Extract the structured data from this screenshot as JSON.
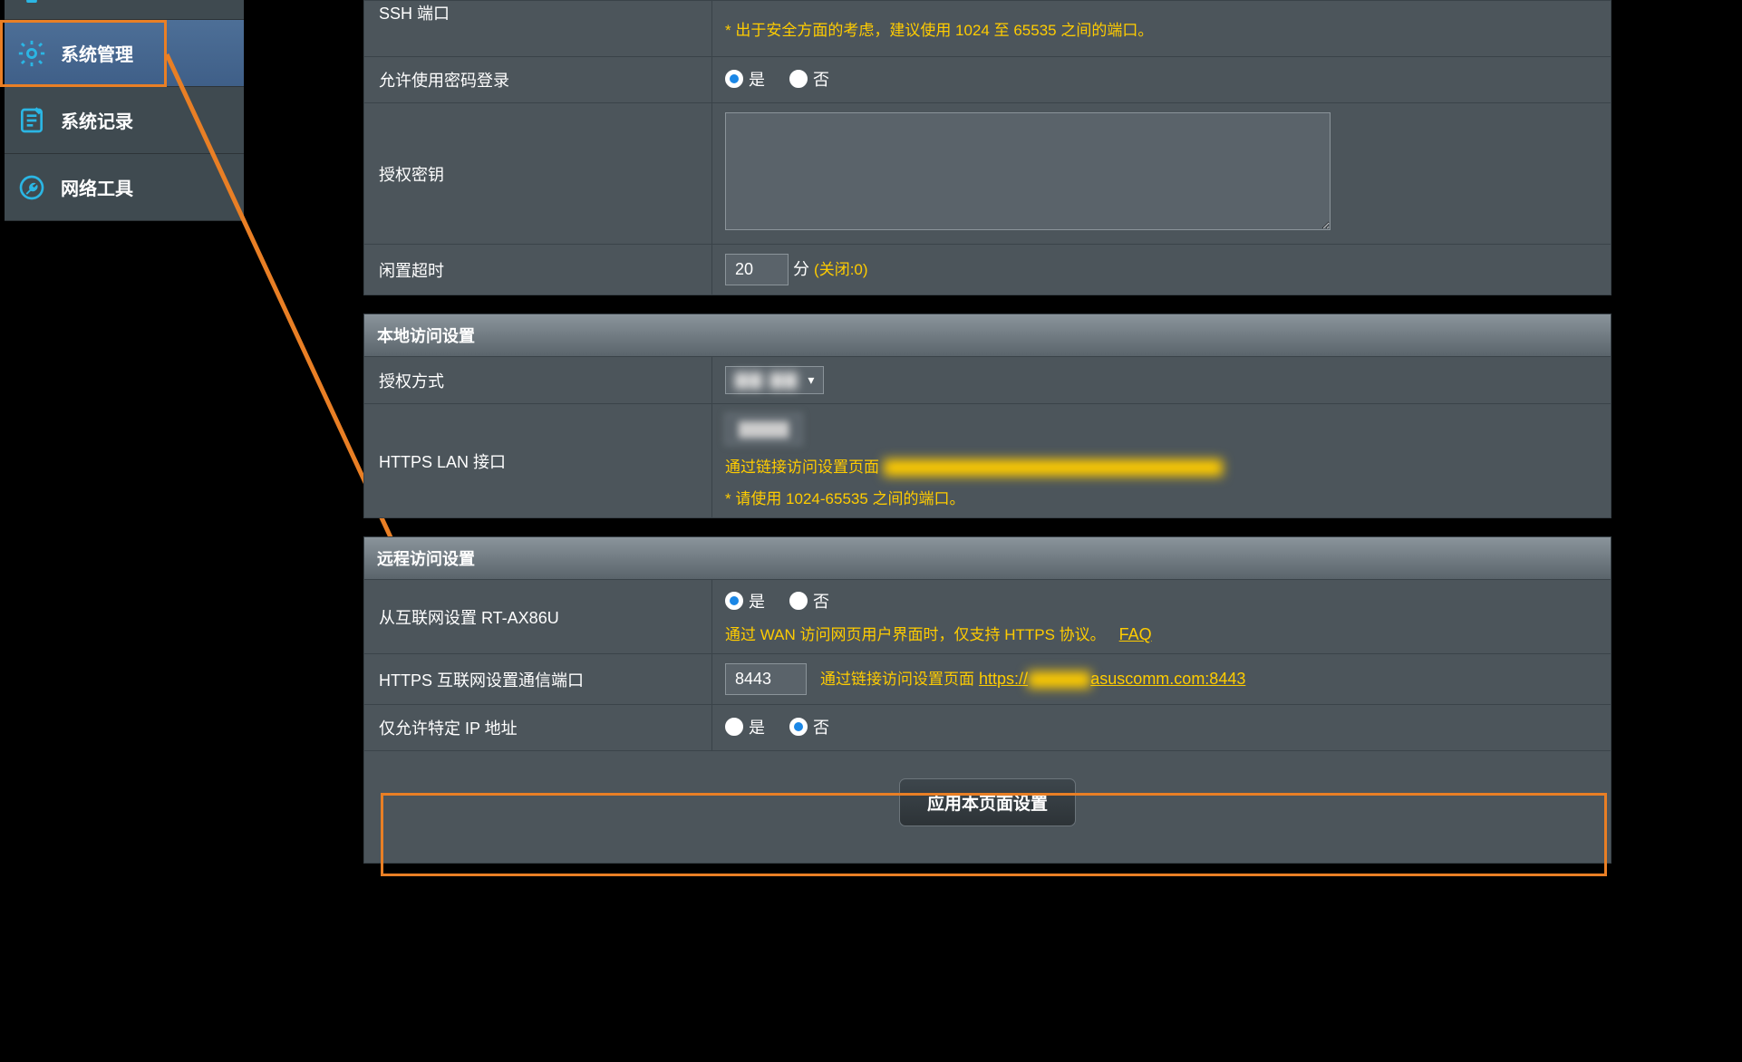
{
  "sidebar": {
    "items": [
      {
        "label": "系统管理",
        "icon": "gear-icon",
        "selected": true
      },
      {
        "label": "系统记录",
        "icon": "log-icon",
        "selected": false
      },
      {
        "label": "网络工具",
        "icon": "wrench-icon",
        "selected": false
      }
    ]
  },
  "rows": {
    "ssh_port": {
      "label": "SSH 端口",
      "hint": "* 出于安全方面的考虑，建议使用 1024 至 65535 之间的端口。"
    },
    "allow_pwd_login": {
      "label": "允许使用密码登录",
      "yes": "是",
      "no": "否",
      "selected": "yes"
    },
    "auth_key": {
      "label": "授权密钥",
      "value": ""
    },
    "idle_timeout": {
      "label": "闲置超时",
      "value": "20",
      "unit": "分",
      "off_text": "(关闭:0)"
    }
  },
  "section_local": {
    "title": "本地访问设置"
  },
  "rows_local": {
    "auth_method": {
      "label": "授权方式",
      "value": "▇▇ ▇▇"
    },
    "https_lan_port": {
      "label": "HTTPS LAN 接口",
      "link_prefix": "通过链接访问设置页面",
      "hint": "* 请使用 1024-65535 之间的端口。"
    }
  },
  "section_remote": {
    "title": "远程访问设置"
  },
  "rows_remote": {
    "enable_from_wan": {
      "label": "从互联网设置 RT-AX86U",
      "yes": "是",
      "no": "否",
      "selected": "yes",
      "note": "通过 WAN 访问网页用户界面时，仅支持 HTTPS 协议。",
      "faq": "FAQ"
    },
    "https_wan_port": {
      "label": "HTTPS 互联网设置通信端口",
      "value": "8443",
      "link_prefix": "通过链接访问设置页面",
      "link_proto": "https://",
      "link_host_tail": "asuscomm.com:8443"
    },
    "only_specific_ip": {
      "label": "仅允许特定 IP 地址",
      "yes": "是",
      "no": "否",
      "selected": "no"
    }
  },
  "apply": {
    "label": "应用本页面设置"
  }
}
